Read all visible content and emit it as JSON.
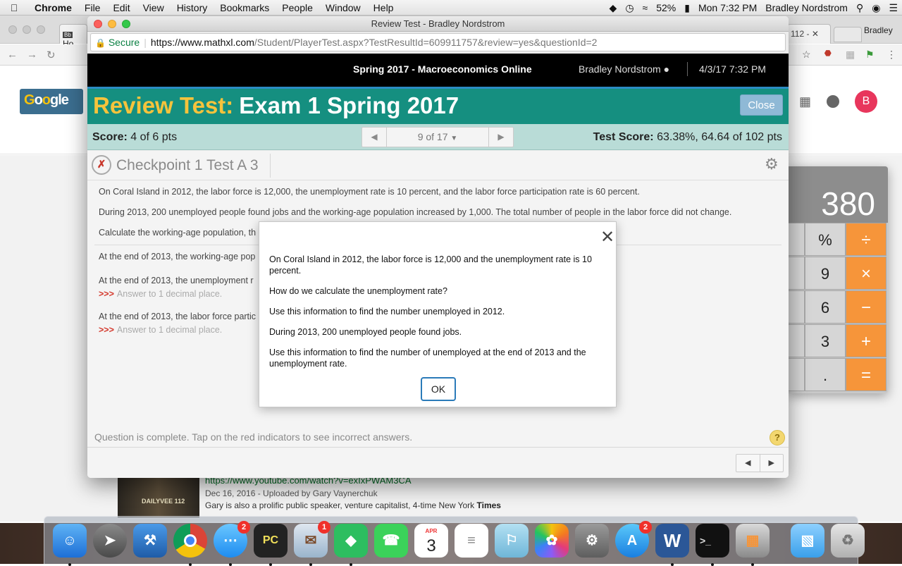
{
  "menubar": {
    "app": "Chrome",
    "items": [
      "File",
      "Edit",
      "View",
      "History",
      "Bookmarks",
      "People",
      "Window",
      "Help"
    ],
    "battery": "52%",
    "clock": "Mon 7:32 PM",
    "user": "Bradley Nordstrom"
  },
  "bg_browser": {
    "tab1_label": "Ho",
    "tab2_label": "112 -",
    "profile": "Bradley",
    "avatar_letter": "B",
    "youtube": {
      "thumb_text": "DAILYVEE 112",
      "url": "https://www.youtube.com/watch?v=exIxPWAM3CA",
      "date": "Dec 16, 2016 - Uploaded by Gary Vaynerchuk",
      "desc_prefix": "Gary is also a prolific public speaker, venture capitalist, 4-time New York",
      "desc_bold": "Times"
    }
  },
  "calculator": {
    "display": "380",
    "keys": {
      "pct": "%",
      "div": "÷",
      "k9": "9",
      "mul": "×",
      "k6": "6",
      "sub": "−",
      "k3": "3",
      "add": "+",
      "dot": ".",
      "eq": "="
    }
  },
  "window": {
    "title": "Review Test - Bradley Nordstrom",
    "secure_label": "Secure",
    "url_host": "https://www.mathxl.com",
    "url_path": "/Student/PlayerTest.aspx?TestResultId=609911757&review=yes&questionId=2"
  },
  "mathxl": {
    "course": "Spring 2017 - Macroeconomics Online",
    "user": "Bradley Nordstrom",
    "datetime": "4/3/17 7:32 PM",
    "title_prefix": "Review Test:",
    "title": "Exam 1 Spring 2017",
    "close_label": "Close",
    "score_label": "Score:",
    "score_value": "4 of 6 pts",
    "question_nav": "9 of 17",
    "test_score_label": "Test Score:",
    "test_score_value": "63.38%, 64.64 of 102 pts",
    "question_title": "Checkpoint 1 Test A 3",
    "p1": "On Coral Island in 2012, the labor force is 12,000, the unemployment rate is 10 percent, and the labor force participation rate is 60 percent.",
    "p2": "During 2013, 200 unemployed people found jobs and the working-age population increased by 1,000. The total number of people in the labor force did not change.",
    "p3": "Calculate the working-age population, th",
    "q1": "At the end of 2013, the working-age pop",
    "q2": "At the end of 2013, the unemployment r",
    "q2_hint": "Answer to 1 decimal place.",
    "q3": "At the end of 2013, the labor force partic",
    "q3_hint": "Answer to 1 decimal place.",
    "hint_marker": ">>>",
    "footer": "Question is complete. Tap on the red indicators to see incorrect answers."
  },
  "modal": {
    "p1": "On Coral Island in 2012, the labor force is 12,000 and the unemployment rate is 10 percent.",
    "p2": "How do we calculate the unemployment rate?",
    "p3": "Use this information to find the number unemployed in 2012.",
    "p4": "During 2013, 200 unemployed people found jobs.",
    "p5": "Use this information to find the number of unemployed at the end of 2013 and the unemployment rate.",
    "ok_label": "OK"
  },
  "dock": {
    "calendar_month": "APR",
    "calendar_day": "3",
    "badges": {
      "messages": "2",
      "mail": "1",
      "appstore": "2"
    }
  }
}
